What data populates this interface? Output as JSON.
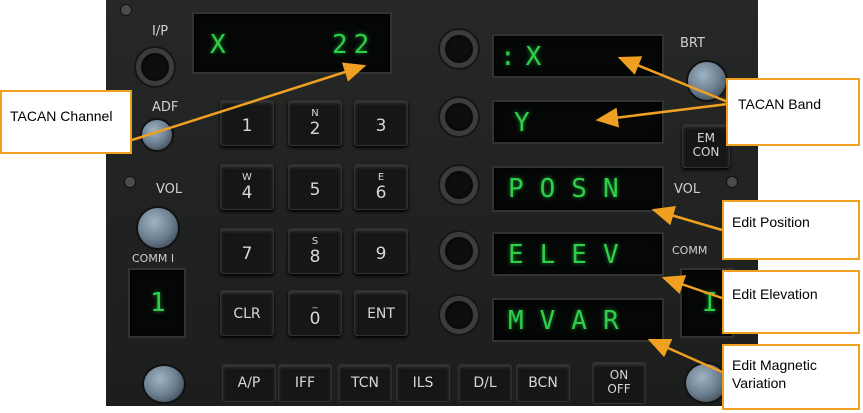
{
  "displays": {
    "channel_band": "X",
    "channel_number": "22",
    "band_x": ":X",
    "band_y": "Y",
    "posn": "POSN",
    "elev": "ELEV",
    "mvar": "MVAR"
  },
  "panel_labels": {
    "ip": "I/P",
    "adf": "ADF",
    "vol_left": "VOL",
    "comm1": "COMM I",
    "brt": "BRT",
    "vol_right": "VOL",
    "comm2": "COMM",
    "em_con_line1": "EM",
    "em_con_line2": "CON",
    "comm1_display": "1",
    "comm2_display": "I"
  },
  "keypad": [
    {
      "sub": "",
      "main": "1"
    },
    {
      "sub": "N",
      "main": "2"
    },
    {
      "sub": "",
      "main": "3"
    },
    {
      "sub": "W",
      "main": "4"
    },
    {
      "sub": "",
      "main": "5"
    },
    {
      "sub": "E",
      "main": "6"
    },
    {
      "sub": "",
      "main": "7"
    },
    {
      "sub": "S",
      "main": "8"
    },
    {
      "sub": "",
      "main": "9"
    },
    {
      "sub": "",
      "main": "CLR"
    },
    {
      "sub": "_",
      "main": "0"
    },
    {
      "sub": "",
      "main": "ENT"
    }
  ],
  "bottom_keys": [
    "A/P",
    "IFF",
    "TCN",
    "ILS",
    "D/L",
    "BCN"
  ],
  "on_off": {
    "line1": "ON",
    "line2": "OFF"
  },
  "callouts": {
    "tacan_channel": "TACAN Channel",
    "tacan_band": "TACAN Band",
    "edit_position": "Edit Position",
    "edit_elevation": "Edit Elevation",
    "edit_mag_var_line1": "Edit Magnetic",
    "edit_mag_var_line2": "Variation"
  },
  "colors": {
    "lcd_green": "#2fcf4a",
    "callout_border": "#f0a020",
    "arrow": "#f0a020"
  }
}
